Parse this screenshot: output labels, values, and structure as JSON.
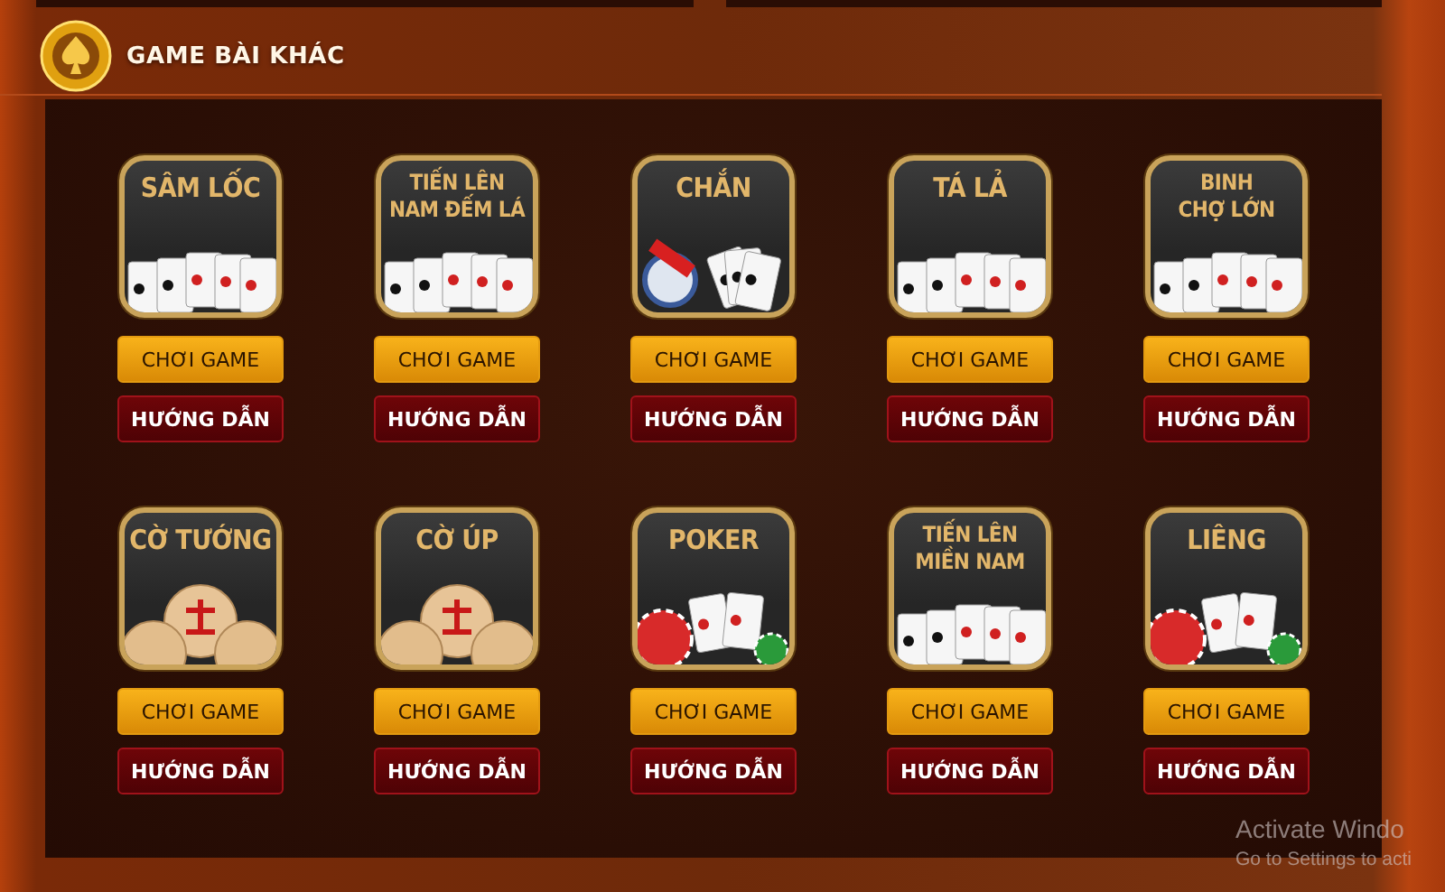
{
  "section": {
    "title": "GAME BÀI KHÁC"
  },
  "games": [
    {
      "title_lines": [
        "SÂM LỐC"
      ],
      "kind": "cards",
      "play": "CHƠI GAME",
      "guide": "HƯỚNG DẪN"
    },
    {
      "title_lines": [
        "TIẾN LÊN",
        "NAM ĐẾM LÁ"
      ],
      "kind": "cards",
      "play": "CHƠI GAME",
      "guide": "HƯỚNG DẪN"
    },
    {
      "title_lines": [
        "CHẮN"
      ],
      "kind": "fan",
      "play": "CHƠI GAME",
      "guide": "HƯỚNG DẪN"
    },
    {
      "title_lines": [
        "TÁ LẢ"
      ],
      "kind": "cards",
      "play": "CHƠI GAME",
      "guide": "HƯỚNG DẪN"
    },
    {
      "title_lines": [
        "BINH",
        "CHỢ LỚN"
      ],
      "kind": "cards",
      "play": "CHƠI GAME",
      "guide": "HƯỚNG DẪN"
    },
    {
      "title_lines": [
        "CỜ TƯỚNG"
      ],
      "kind": "xiangqi",
      "play": "CHƠI GAME",
      "guide": "HƯỚNG DẪN"
    },
    {
      "title_lines": [
        "CỜ ÚP"
      ],
      "kind": "xiangqi",
      "play": "CHƠI GAME",
      "guide": "HƯỚNG DẪN"
    },
    {
      "title_lines": [
        "POKER"
      ],
      "kind": "chips",
      "play": "CHƠI GAME",
      "guide": "HƯỚNG DẪN"
    },
    {
      "title_lines": [
        "TIẾN LÊN",
        "MIỀN NAM"
      ],
      "kind": "cards",
      "play": "CHƠI GAME",
      "guide": "HƯỚNG DẪN"
    },
    {
      "title_lines": [
        "LIÊNG"
      ],
      "kind": "chips",
      "play": "CHƠI GAME",
      "guide": "HƯỚNG DẪN"
    }
  ],
  "os_notice": {
    "title": "Activate Windo",
    "subtitle": "Go to Settings to acti"
  }
}
